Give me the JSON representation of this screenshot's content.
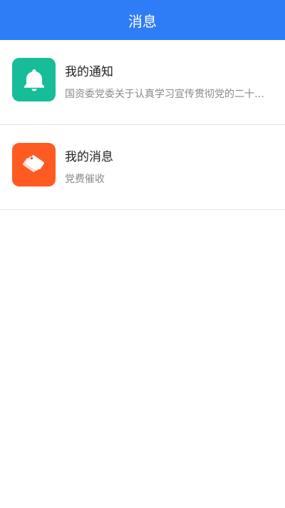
{
  "header": {
    "title": "消息"
  },
  "items": [
    {
      "title": "我的通知",
      "subtitle": "国资委党委关于认真学习宣传贯彻党的二十大精神的通知",
      "icon": "bell-icon",
      "color": "#17bd99"
    },
    {
      "title": "我的消息",
      "subtitle": "党费催收",
      "icon": "tags-icon",
      "color": "#ff5a22"
    }
  ]
}
